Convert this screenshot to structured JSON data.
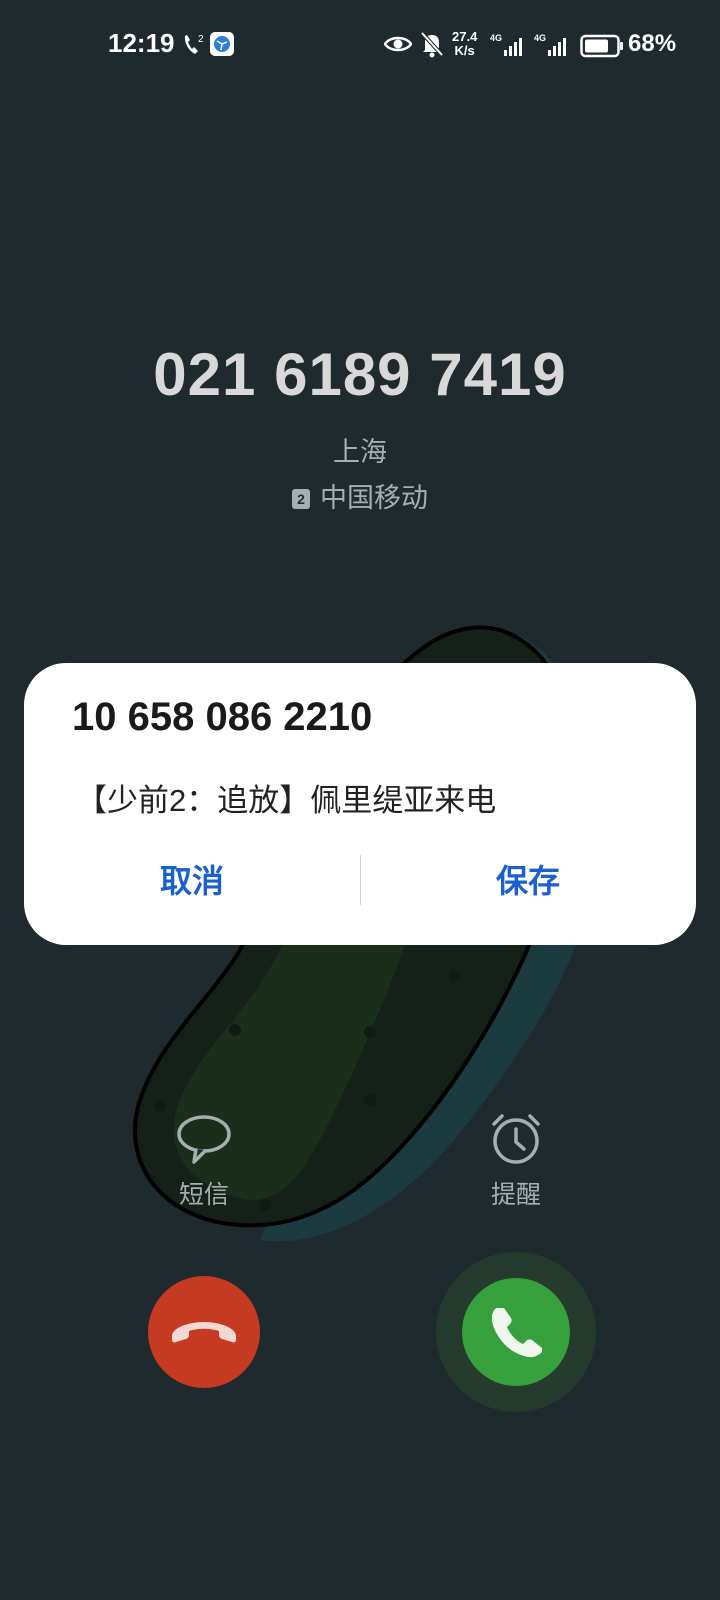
{
  "status_bar": {
    "time": "12:19",
    "call_sim": "2",
    "net_speed_value": "27.4",
    "net_speed_unit": "K/s",
    "network_1": "4G",
    "network_2": "4G",
    "battery": "68%"
  },
  "caller": {
    "number": "021 6189 7419",
    "location": "上海",
    "sim_slot": "2",
    "carrier": "中国移动"
  },
  "dialog": {
    "title": "10 658 086 2210",
    "message": "【少前2：追放】佩里缇亚来电",
    "cancel_label": "取消",
    "save_label": "保存",
    "button_color": "#1b60cf"
  },
  "actions": {
    "sms_label": "短信",
    "remind_label": "提醒"
  },
  "colors": {
    "background": "#1f2a2e",
    "decline": "#c63a22",
    "accept": "#36a03d"
  }
}
